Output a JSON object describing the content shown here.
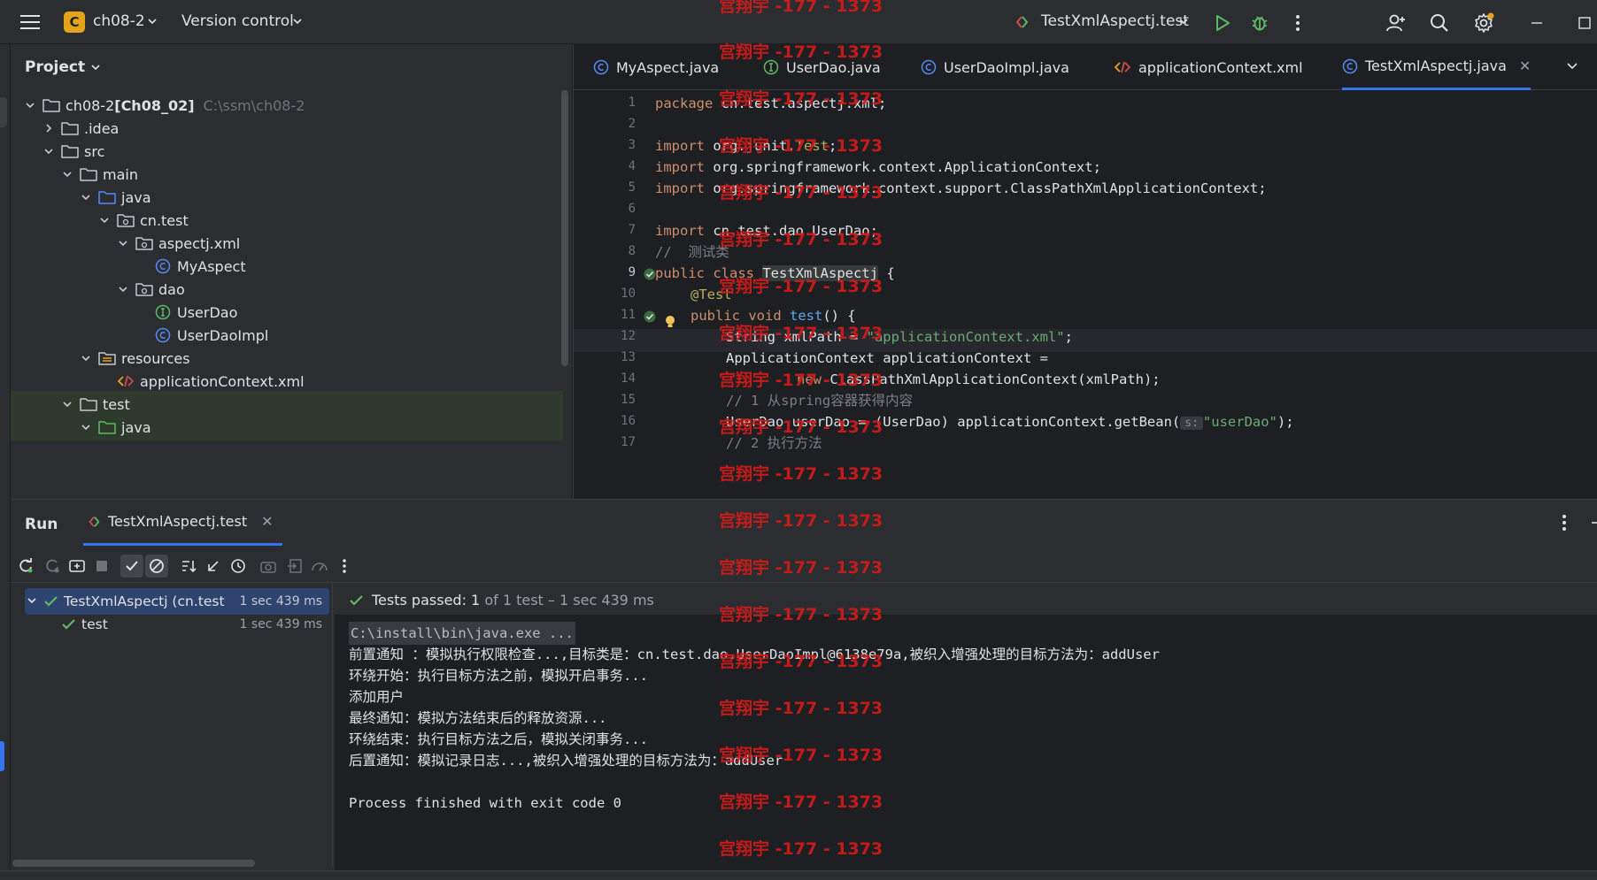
{
  "titlebar": {
    "project_badge": "C",
    "project_name": "ch08-2",
    "version_control": "Version control",
    "run_config": "TestXmlAspectj.test"
  },
  "project_panel": {
    "header": "Project",
    "tree": [
      {
        "label": "ch08-2",
        "bold_suffix": "[Ch08_02]",
        "path": "C:\\ssm\\ch08-2",
        "level": 0,
        "icon": "folder-icon",
        "chevron": "down"
      },
      {
        "label": ".idea",
        "level": 1,
        "icon": "folder-icon",
        "chevron": "right"
      },
      {
        "label": "src",
        "level": 1,
        "icon": "folder-icon",
        "chevron": "down"
      },
      {
        "label": "main",
        "level": 2,
        "icon": "folder-icon",
        "chevron": "down"
      },
      {
        "label": "java",
        "level": 3,
        "icon": "source-folder-icon",
        "chevron": "down"
      },
      {
        "label": "cn.test",
        "level": 4,
        "icon": "package-icon",
        "chevron": "down"
      },
      {
        "label": "aspectj.xml",
        "level": 5,
        "icon": "package-icon",
        "chevron": "down"
      },
      {
        "label": "MyAspect",
        "level": 6,
        "icon": "class-icon",
        "chevron": ""
      },
      {
        "label": "dao",
        "level": 5,
        "icon": "package-icon",
        "chevron": "down"
      },
      {
        "label": "UserDao",
        "level": 6,
        "icon": "interface-icon",
        "chevron": ""
      },
      {
        "label": "UserDaoImpl",
        "level": 6,
        "icon": "class-icon",
        "chevron": ""
      },
      {
        "label": "resources",
        "level": 3,
        "icon": "resources-folder-icon",
        "chevron": "down"
      },
      {
        "label": "applicationContext.xml",
        "level": 4,
        "icon": "xml-file-icon",
        "chevron": ""
      },
      {
        "label": "test",
        "level": 2,
        "icon": "folder-icon",
        "chevron": "down"
      },
      {
        "label": "java",
        "level": 3,
        "icon": "test-folder-icon",
        "chevron": "down"
      }
    ]
  },
  "editor": {
    "tabs": [
      {
        "label": "MyAspect.java",
        "icon": "class-icon"
      },
      {
        "label": "UserDao.java",
        "icon": "interface-icon"
      },
      {
        "label": "UserDaoImpl.java",
        "icon": "class-icon"
      },
      {
        "label": "applicationContext.xml",
        "icon": "xml-file-icon"
      },
      {
        "label": "TestXmlAspectj.java",
        "icon": "class-icon",
        "active": true
      }
    ],
    "line_numbers": [
      "1",
      "2",
      "3",
      "4",
      "5",
      "6",
      "7",
      "8",
      "9",
      "10",
      "11",
      "12",
      "13",
      "14",
      "15",
      "16",
      "17"
    ],
    "current_line": "9",
    "code": {
      "l1_kw": "package",
      "l1_rest": " cn.test.aspectj.xml;",
      "l3_kw": "import",
      "l3_a": " org.junit.",
      "l3_ann": "Test",
      "l3_b": ";",
      "l4_kw": "import",
      "l4_rest": " org.springframework.context.ApplicationContext;",
      "l5_kw": "import",
      "l5_rest": " org.springframework.context.support.ClassPathXmlApplicationContext;",
      "l7_kw": "import",
      "l7_rest": " cn.test.dao.UserDao;",
      "l8_cmt": "//  测试类",
      "l9_kw": "public class ",
      "l9_cls": "TestXmlAspectj",
      "l9_rest": " {",
      "l10_ann": "@Test",
      "l11_kw": "public void ",
      "l11_fn": "test",
      "l11_rest": "() {",
      "l12_a": "String xmlPath = ",
      "l12_str": "\"applicationContext.xml\"",
      "l12_b": ";",
      "l13": "ApplicationContext applicationContext =",
      "l14_kw": "new",
      "l14_rest": " ClassPathXmlApplicationContext(xmlPath);",
      "l15_cmt": "// 1 从spring容器获得内容",
      "l16_a": "UserDao userDao = (UserDao) applicationContext.getBean(",
      "l16_hint": "s:",
      "l16_str": "\"userDao\"",
      "l16_b": ");",
      "l17_cmt": "// 2 执行方法"
    }
  },
  "run_panel": {
    "title": "Run",
    "tab_label": "TestXmlAspectj.test",
    "test_tree": [
      {
        "label": "TestXmlAspectj (cn.test",
        "time": "1 sec 439 ms",
        "selected": true
      },
      {
        "label": "test",
        "time": "1 sec 439 ms"
      }
    ],
    "status": {
      "passed": "Tests passed: ",
      "count": "1",
      "rest": " of 1 test – 1 sec 439 ms"
    },
    "console": [
      "C:\\install\\bin\\java.exe ...",
      "前置通知 ：模拟执行权限检查...,目标类是：cn.test.dao.UserDaoImpl@6138e79a,被织入增强处理的目标方法为：addUser",
      "环绕开始：执行目标方法之前，模拟开启事务...",
      "添加用户",
      "最终通知：模拟方法结束后的释放资源...",
      "环绕结束：执行目标方法之后，模拟关闭事务...",
      "后置通知：模拟记录日志...,被织入增强处理的目标方法为：addUser",
      "",
      "Process finished with exit code 0"
    ]
  },
  "watermark": "宫翔宇 -177 - 1373",
  "colors": {
    "accent": "#3574f0",
    "pass_green": "#5fb865",
    "watermark_red": "#d11a1a",
    "badge_yellow": "#e3a41a"
  }
}
